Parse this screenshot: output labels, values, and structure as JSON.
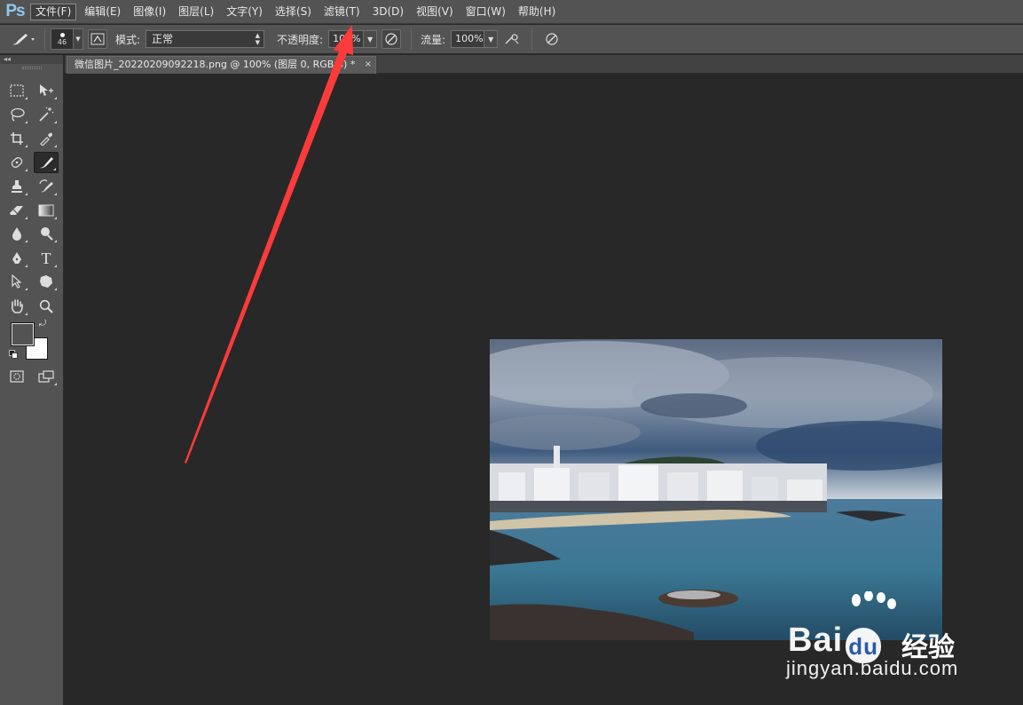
{
  "app": {
    "logo": "Ps"
  },
  "menu": [
    {
      "label": "文件(F)",
      "active": true
    },
    {
      "label": "编辑(E)"
    },
    {
      "label": "图像(I)"
    },
    {
      "label": "图层(L)"
    },
    {
      "label": "文字(Y)"
    },
    {
      "label": "选择(S)"
    },
    {
      "label": "滤镜(T)"
    },
    {
      "label": "3D(D)"
    },
    {
      "label": "视图(V)"
    },
    {
      "label": "窗口(W)"
    },
    {
      "label": "帮助(H)"
    }
  ],
  "options": {
    "brush_size": "46",
    "mode_label": "模式:",
    "mode_value": "正常",
    "opacity_label": "不透明度:",
    "opacity_value": "100%",
    "flow_label": "流量:",
    "flow_value": "100%"
  },
  "toolbox": {
    "collapse": "◂◂"
  },
  "document": {
    "tab_title": "微信图片_20220209092218.png @ 100% (图层 0, RGB/8) *",
    "close_glyph": "×"
  },
  "watermark": {
    "brand": "Bai",
    "brand_tail": "u",
    "brand_cn": "经验",
    "url": "jingyan.baidu.com"
  },
  "colors": {
    "arrow": "#ff3a3a",
    "foreground": "#535353",
    "background": "#ffffff"
  },
  "icons": {
    "brush": "brush-icon",
    "toggle_brush_panel": "brush-panel-icon",
    "airbrush": "airbrush-icon",
    "tablet_pressure": "pressure-icon"
  }
}
